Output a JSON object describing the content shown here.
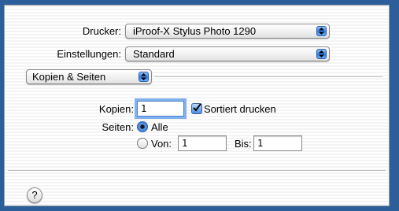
{
  "printer": {
    "label": "Drucker:",
    "value": "iProof-X Stylus Photo 1290"
  },
  "presets": {
    "label": "Einstellungen:",
    "value": "Standard"
  },
  "panel": {
    "value": "Kopien & Seiten"
  },
  "copies": {
    "label": "Kopien:",
    "value": "1",
    "collate_label": "Sortiert drucken",
    "collate_checked": true
  },
  "pages": {
    "label": "Seiten:",
    "all_label": "Alle",
    "from_label": "Von:",
    "from_value": "1",
    "to_label": "Bis:",
    "to_value": "1",
    "selected": "all"
  },
  "help": {
    "glyph": "?",
    "icon": "help-icon"
  },
  "colors": {
    "accent": "#2f7be0",
    "frame": "#2c5f9a"
  }
}
